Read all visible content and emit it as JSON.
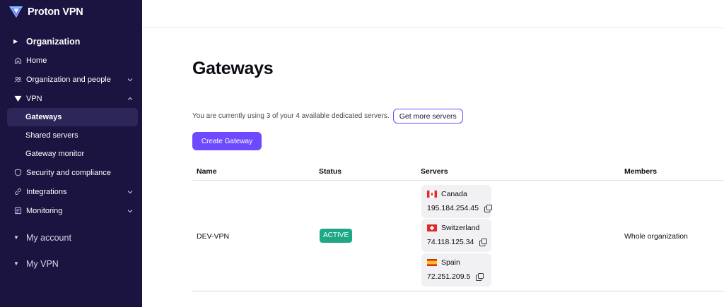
{
  "brand": {
    "name": "Proton VPN"
  },
  "sidebar": {
    "organization_label": "Organization",
    "items": [
      {
        "label": "Home",
        "icon": "home-icon"
      },
      {
        "label": "Organization and people",
        "icon": "people-icon"
      },
      {
        "label": "VPN",
        "icon": "vpn-icon"
      },
      {
        "label": "Security and compliance",
        "icon": "shield-icon"
      },
      {
        "label": "Integrations",
        "icon": "link-icon"
      },
      {
        "label": "Monitoring",
        "icon": "monitor-icon"
      }
    ],
    "vpn_sub": [
      {
        "label": "Gateways"
      },
      {
        "label": "Shared servers"
      },
      {
        "label": "Gateway monitor"
      }
    ],
    "my_account_label": "My account",
    "my_vpn_label": "My VPN"
  },
  "main": {
    "title": "Gateways",
    "usage_text": "You are currently using 3 of your 4 available dedicated servers.",
    "get_more_label": "Get more servers",
    "create_label": "Create Gateway",
    "columns": {
      "name": "Name",
      "status": "Status",
      "servers": "Servers",
      "members": "Members"
    },
    "rows": [
      {
        "name": "DEV-VPN",
        "status": "ACTIVE",
        "members": "Whole organization",
        "servers": [
          {
            "country": "Canada",
            "ip": "195.184.254.45",
            "flag": "canada-flag-icon"
          },
          {
            "country": "Switzerland",
            "ip": "74.118.125.34",
            "flag": "switzerland-flag-icon"
          },
          {
            "country": "Spain",
            "ip": "72.251.209.5",
            "flag": "spain-flag-icon"
          }
        ]
      }
    ]
  },
  "colors": {
    "sidebar": "#1b1340",
    "accent": "#6d4aff",
    "active_status": "#1ea885"
  }
}
